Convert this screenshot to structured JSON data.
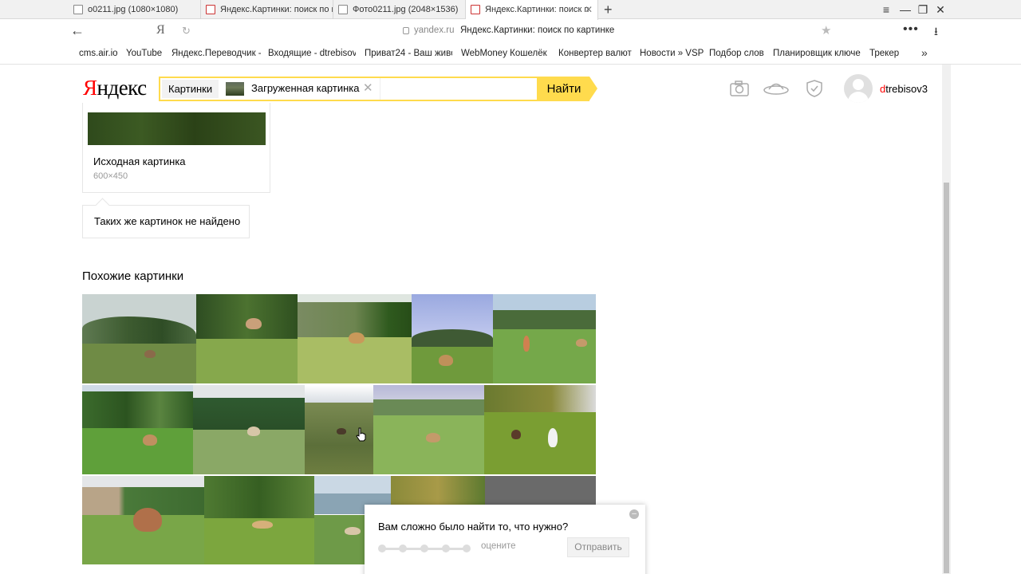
{
  "browser": {
    "tabs": [
      {
        "label": "o0211.jpg (1080×1080)",
        "icon": "image-icon",
        "active": false
      },
      {
        "label": "Яндекс.Картинки: поиск по к",
        "icon": "yandex-images-icon",
        "active": false
      },
      {
        "label": "Фото0211.jpg (2048×1536)",
        "icon": "image-icon",
        "active": false
      },
      {
        "label": "Яндекс.Картинки: поиск п",
        "icon": "yandex-images-icon",
        "active": true
      }
    ],
    "new_tab": "+",
    "window_controls": {
      "menu": "≡",
      "minimize": "—",
      "restore": "❐",
      "close": "✕"
    },
    "tab_close": "✕",
    "address": {
      "back": "←",
      "yandex_button": "Я",
      "reload": "↻",
      "domain": "yandex.ru",
      "page_title": "Яндекс.Картинки: поиск по картинке",
      "star": "★",
      "more": "•••",
      "download": "⭳"
    },
    "bookmarks": [
      "cms.air.io",
      "YouTube",
      "Яндекс.Переводчик -",
      "Входящие - dtrebisov",
      "Приват24 - Ваш живо",
      "WebMoney Кошелёк",
      "Конвертер валют",
      "Новости » VSP",
      "Подбор слов",
      "Планировщик ключе",
      "Трекер"
    ],
    "bookmarks_more": "»"
  },
  "header": {
    "logo_first": "Я",
    "logo_rest": "ндекс",
    "search": {
      "service_chip": "Картинки",
      "image_chip_label": "Загруженная картинка",
      "clear": "✕"
    },
    "find_button": "Найти",
    "icons": [
      "camera-icon",
      "disk-icon",
      "shield-check-icon"
    ],
    "user": {
      "first_letter": "d",
      "rest": "trebisov3"
    }
  },
  "source": {
    "title": "Исходная картинка",
    "size": "600×450"
  },
  "not_found": "Таких же картинок не найдено",
  "similar": {
    "title": "Похожие картинки"
  },
  "feedback": {
    "question": "Вам сложно было найти то, что нужно?",
    "rate_label": "оцените",
    "submit": "Отправить",
    "close": "–"
  },
  "colors": {
    "accent_yellow": "#ffdb4d",
    "logo_red": "#ff0000"
  }
}
